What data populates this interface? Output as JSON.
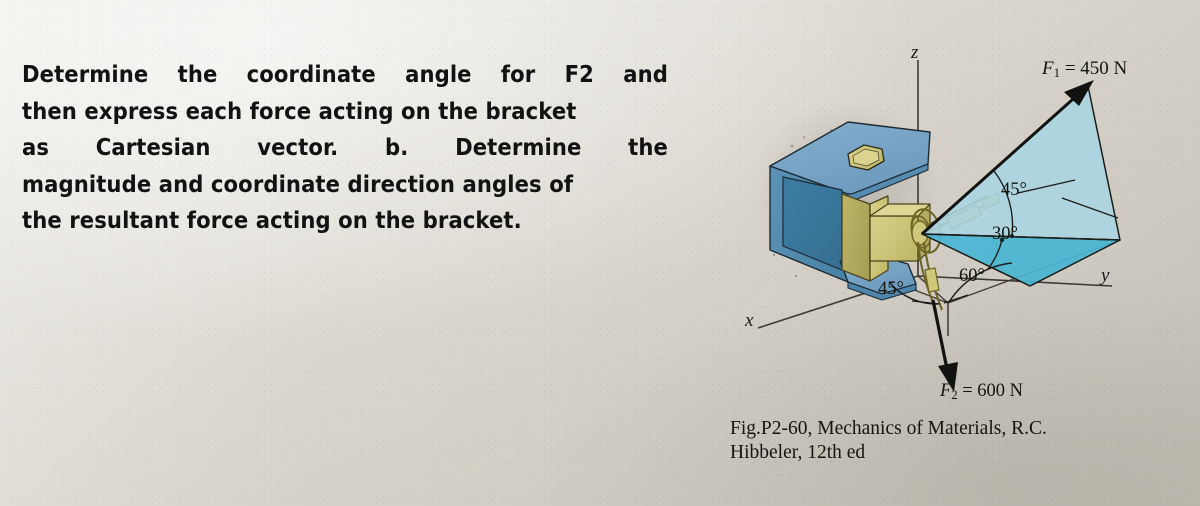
{
  "problem": {
    "lines": [
      "Determine the coordinate angle for F2 and",
      "then express each force acting on the bracket",
      "as Cartesian vector. b. Determine the",
      "magnitude and coordinate direction angles of",
      "the resultant force acting on the bracket."
    ],
    "line1_words": [
      "Determine",
      "the",
      "coordinate",
      "angle",
      "for",
      "F2",
      "and"
    ],
    "line3_words": [
      "as",
      "Cartesian",
      "vector.",
      "b.",
      "Determine",
      "the"
    ]
  },
  "figure": {
    "axes": {
      "z": "z",
      "x": "x",
      "y": "y"
    },
    "forces": [
      {
        "id": "F1",
        "symbol": "F",
        "subscript": "1",
        "equals": "=",
        "magnitude": "450",
        "unit": "N",
        "label": "F₁ = 450 N"
      },
      {
        "id": "F2",
        "symbol": "F",
        "subscript": "2",
        "equals": "=",
        "magnitude": "600",
        "unit": "N",
        "label": "F₂ = 600 N"
      }
    ],
    "angles": [
      {
        "id": "angle-45-upper",
        "value": "45°",
        "describes": "angle between F1 and its horizontal projection"
      },
      {
        "id": "angle-30",
        "value": "30°",
        "describes": "angle of F1 projection from the y axis"
      },
      {
        "id": "angle-60",
        "value": "60°",
        "describes": "angle of F2 projection measured in the xy plane"
      },
      {
        "id": "angle-45-lower",
        "value": "45°",
        "describes": "angle at the bracket in the xy plane"
      }
    ],
    "colors": {
      "bracket_blue": "#6b9cc0",
      "bracket_blue_dark": "#3f7fa3",
      "bracket_yellow": "#cfc77a",
      "triangle_light": "#a9d5e3",
      "triangle_dark": "#49b5d4",
      "line": "#1c1c18",
      "paper": "#d8d4cb"
    }
  },
  "caption": {
    "line1": "Fig.P2-60, Mechanics of Materials, R.C.",
    "line2": "Hibbeler, 12th ed"
  },
  "chart_data": {
    "type": "diagram",
    "title": "Fig. P2-60 Bracket with two forces",
    "description": "3D Cartesian axes x, y, z with a bracket at the origin; force F1 = 450 N directed up and to the right at 45 degrees above its horizontal projection, whose projection makes 30 degrees with the y axis; force F2 = 600 N directed downward with 60 degrees and 45 degrees reference angles in the xy plane.",
    "annotations": [
      "z",
      "x",
      "y",
      "F₁ = 450 N",
      "45°",
      "30°",
      "60°",
      "45°",
      "F₂ = 600 N"
    ]
  }
}
